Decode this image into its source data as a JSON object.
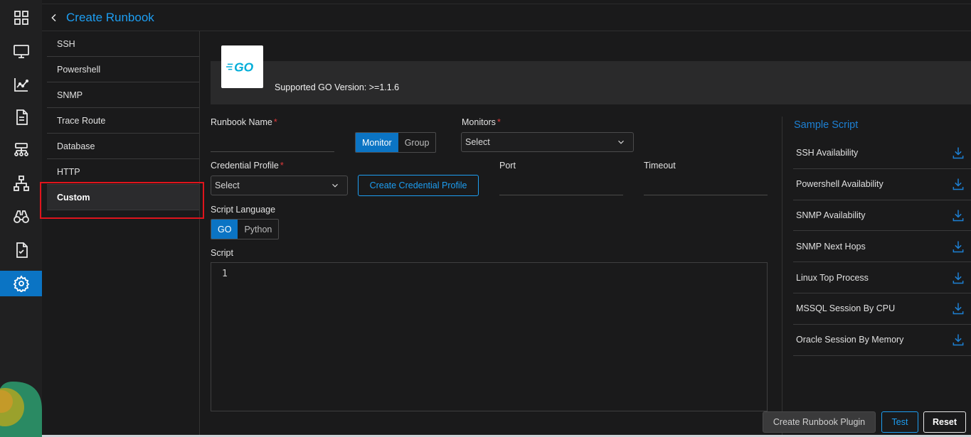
{
  "header": {
    "title": "Create Runbook"
  },
  "rail": {
    "items": [
      "dashboard-icon",
      "monitor-icon",
      "metrics-icon",
      "report-icon",
      "network-icon",
      "topology-icon",
      "explorer-icon",
      "audit-icon",
      "settings-icon"
    ],
    "active": "settings-icon",
    "accent": "#0b74c4"
  },
  "submenu": {
    "items": [
      "SSH",
      "Powershell",
      "SNMP",
      "Trace Route",
      "Database",
      "HTTP",
      "Custom"
    ],
    "active": "Custom"
  },
  "banner": {
    "logo_text": "GO",
    "version_text": "Supported GO Version: >=1.1.6"
  },
  "form": {
    "runbook_name_label": "Runbook Name",
    "runbook_name_value": "",
    "target_toggle": {
      "options": [
        "Monitor",
        "Group"
      ],
      "selected": "Monitor"
    },
    "monitors_label": "Monitors",
    "monitors_value": "Select",
    "credential_label": "Credential Profile",
    "credential_value": "Select",
    "create_credential_label": "Create Credential Profile",
    "port_label": "Port",
    "port_value": "",
    "timeout_label": "Timeout",
    "timeout_value": "",
    "script_language_label": "Script Language",
    "language_toggle": {
      "options": [
        "GO",
        "Python"
      ],
      "selected": "GO"
    },
    "script_label": "Script",
    "script_line_number": "1"
  },
  "sample": {
    "title": "Sample Script",
    "items": [
      "SSH Availability",
      "Powershell Availability",
      "SNMP Availability",
      "SNMP Next Hops",
      "Linux Top Process",
      "MSSQL Session By CPU",
      "Oracle Session By Memory"
    ]
  },
  "footer": {
    "create_label": "Create Runbook Plugin",
    "test_label": "Test",
    "reset_label": "Reset"
  },
  "colors": {
    "accent_blue": "#1d9ef2",
    "required_red": "#e03a3a",
    "highlight_red": "#e0141c"
  }
}
